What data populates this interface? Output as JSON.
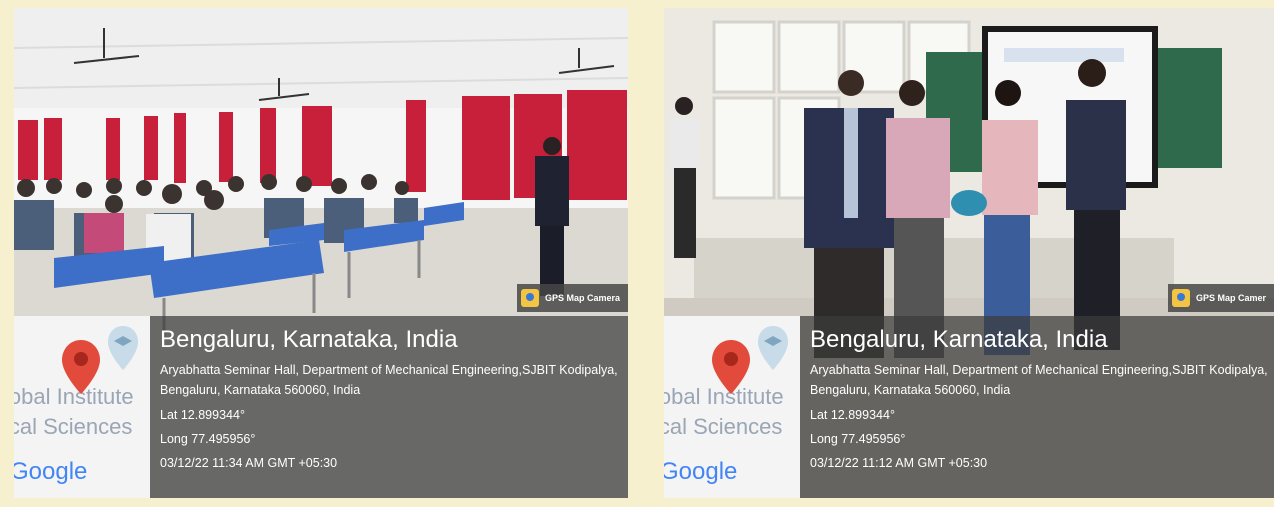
{
  "photos": [
    {
      "badge": "GPS Map Camera",
      "map_text_line1": "lobal Institute",
      "map_text_line2": "ical Sciences",
      "google": "Google",
      "city": "Bengaluru, Karnataka, India",
      "address": "Aryabhatta Seminar Hall, Department of Mechanical Engineering,SJBIT Kodipalya, Bengaluru, Karnataka 560060, India",
      "lat": "Lat 12.899344°",
      "long": "Long 77.495956°",
      "timestamp": "03/12/22 11:34 AM GMT +05:30"
    },
    {
      "badge": "GPS Map Camer",
      "map_text_line1": "lobal Institute",
      "map_text_line2": "ical Sciences",
      "google": "Google",
      "city": "Bengaluru, Karnataka, India",
      "address": "Aryabhatta Seminar Hall, Department of Mechanical Engineering,SJBIT Kodipalya, Bengaluru, Karnataka 560060, India",
      "lat": "Lat 12.899344°",
      "long": "Long 77.495956°",
      "timestamp": "03/12/22 11:12 AM GMT +05:30"
    }
  ],
  "colors": {
    "background": "#f6f0cf",
    "curtain": "#c8203a",
    "desk": "#3d6fc8",
    "overlay": "#3c3c3c",
    "pin": "#e24a3b"
  }
}
